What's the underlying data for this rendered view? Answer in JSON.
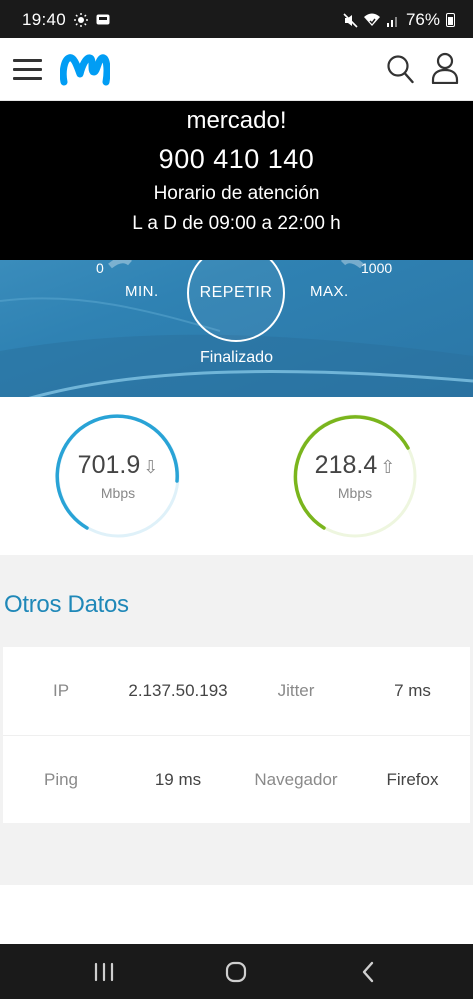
{
  "status_bar": {
    "time": "19:40",
    "battery": "76%",
    "icons": [
      "brightness-icon",
      "cast-icon",
      "mute-icon",
      "wifi-icon",
      "signal-icon",
      "battery-icon"
    ]
  },
  "header": {
    "menu_icon": "menu-icon",
    "logo": "movistar-logo",
    "search_icon": "search-icon",
    "account_icon": "user-icon"
  },
  "banner": {
    "line1": "mercado!",
    "phone": "900 410 140",
    "hours_title": "Horario de atención",
    "hours": "L a D de 09:00 a 22:00 h"
  },
  "speedtest": {
    "min_value": "0",
    "max_value": "1000",
    "min_label": "MIN.",
    "max_label": "MAX.",
    "repeat_label": "REPETIR",
    "status": "Finalizado"
  },
  "results": {
    "download": {
      "value": "701.9",
      "unit": "Mbps",
      "icon": "arrow-down-icon",
      "color": "#29a3d6"
    },
    "upload": {
      "value": "218.4",
      "unit": "Mbps",
      "icon": "arrow-up-icon",
      "color": "#7ab51d"
    }
  },
  "other_data": {
    "title": "Otros Datos",
    "rows": [
      {
        "label1": "IP",
        "value1": "2.137.50.193",
        "label2": "Jitter",
        "value2": "7 ms"
      },
      {
        "label1": "Ping",
        "value1": "19 ms",
        "label2": "Navegador",
        "value2": "Firefox"
      }
    ]
  },
  "nav": {
    "icons": [
      "recent-apps-icon",
      "home-icon",
      "back-icon"
    ]
  },
  "colors": {
    "brand_blue": "#1f88b8",
    "hero_blue": "#2f82b3",
    "download_blue": "#29a3d6",
    "upload_green": "#7ab51d"
  }
}
